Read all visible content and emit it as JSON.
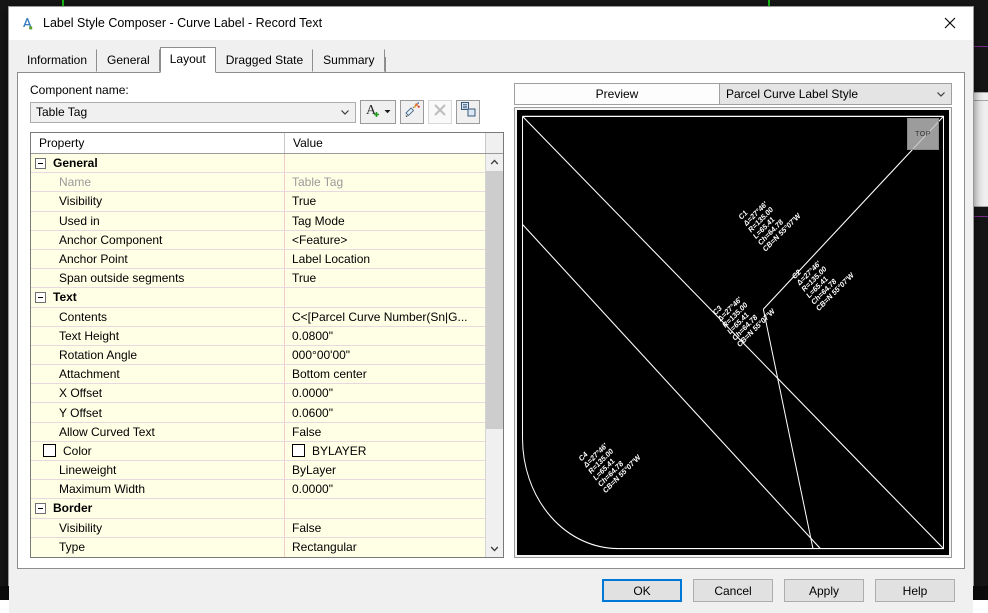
{
  "window": {
    "title": "Label Style Composer - Curve Label - Record Text",
    "icon": "autocad-a-icon",
    "close_label": "✕"
  },
  "tabs": [
    {
      "label": "Information",
      "active": false
    },
    {
      "label": "General",
      "active": false
    },
    {
      "label": "Layout",
      "active": true
    },
    {
      "label": "Dragged State",
      "active": false
    },
    {
      "label": "Summary",
      "active": false
    }
  ],
  "component": {
    "label": "Component name:",
    "value": "Table Tag",
    "buttons": [
      {
        "name": "create-text-component-button",
        "icon": "add-text-icon",
        "disabled": false,
        "has_dropdown": true
      },
      {
        "name": "copy-component-button",
        "icon": "copy-component-icon",
        "disabled": false,
        "has_dropdown": false
      },
      {
        "name": "delete-component-button",
        "icon": "delete-x-icon",
        "disabled": true,
        "has_dropdown": false
      },
      {
        "name": "component-draw-order-button",
        "icon": "draw-order-icon",
        "disabled": false,
        "has_dropdown": false
      }
    ]
  },
  "grid": {
    "columns": [
      "Property",
      "Value"
    ],
    "rows": [
      {
        "type": "group",
        "property": "General",
        "value": ""
      },
      {
        "type": "item",
        "property": "Name",
        "value": "Table Tag",
        "disabled": true
      },
      {
        "type": "item",
        "property": "Visibility",
        "value": "True"
      },
      {
        "type": "item",
        "property": "Used in",
        "value": "Tag Mode"
      },
      {
        "type": "item",
        "property": "Anchor Component",
        "value": "<Feature>"
      },
      {
        "type": "item",
        "property": "Anchor Point",
        "value": "Label Location"
      },
      {
        "type": "item",
        "property": "Span outside segments",
        "value": "True"
      },
      {
        "type": "group",
        "property": "Text",
        "value": ""
      },
      {
        "type": "item",
        "property": "Contents",
        "value": "C<[Parcel Curve Number(Sn|G..."
      },
      {
        "type": "item",
        "property": "Text Height",
        "value": "0.0800\""
      },
      {
        "type": "item",
        "property": "Rotation Angle",
        "value": "000°00'00\""
      },
      {
        "type": "item",
        "property": "Attachment",
        "value": "Bottom center"
      },
      {
        "type": "item",
        "property": "X Offset",
        "value": "0.0000\""
      },
      {
        "type": "item",
        "property": "Y Offset",
        "value": "0.0600\""
      },
      {
        "type": "item",
        "property": "Allow Curved Text",
        "value": "False"
      },
      {
        "type": "color",
        "property": "Color",
        "value": "BYLAYER",
        "swatch": "#ffffff"
      },
      {
        "type": "item",
        "property": "Lineweight",
        "value": "ByLayer"
      },
      {
        "type": "item",
        "property": "Maximum Width",
        "value": "0.0000\""
      },
      {
        "type": "group",
        "property": "Border",
        "value": ""
      },
      {
        "type": "item",
        "property": "Visibility",
        "value": "False"
      },
      {
        "type": "item",
        "property": "Type",
        "value": "Rectangular",
        "clipped": true
      }
    ]
  },
  "preview": {
    "title": "Preview",
    "style": "Parcel Curve Label Style",
    "viewcube": "TOP",
    "background": "#000000",
    "line_color": "#ffffff",
    "labels": [
      {
        "text": "C1\nΔ=27°46'\nR=135.00\nL=65.41\nCh=64.78\nCB=N 55°07'W",
        "rotation": -45
      },
      {
        "text": "C2\nΔ=27°46'\nR=135.00\nL=65.41\nCh=64.78\nCB=N 55°07'W",
        "rotation": -45
      },
      {
        "text": "C3\nΔ=27°46'\nR=135.00\nL=65.41\nCh=64.78\nCB=N 55°07'W",
        "rotation": -45
      },
      {
        "text": "C4\nΔ=27°46'\nR=135.00\nL=65.41\nCh=64.78\nCB=N 55°07'W",
        "rotation": -45
      }
    ]
  },
  "footer": {
    "buttons": [
      {
        "label": "OK",
        "name": "ok-button",
        "default": true
      },
      {
        "label": "Cancel",
        "name": "cancel-button",
        "default": false
      },
      {
        "label": "Apply",
        "name": "apply-button",
        "default": false
      },
      {
        "label": "Help",
        "name": "help-button",
        "default": false
      }
    ]
  }
}
